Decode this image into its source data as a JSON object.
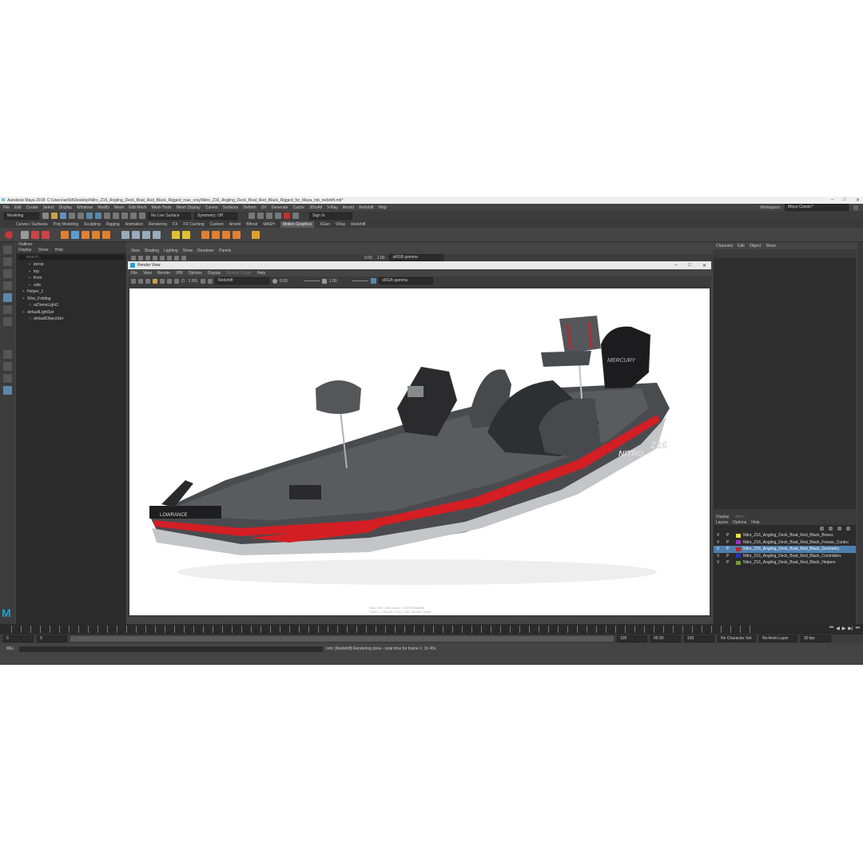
{
  "window": {
    "title": "Autodesk Maya 2018: C:\\Users\\art3d\\Desktop\\Nitro_Z16_Angling_Deck_Boat_Red_Black_Rigged_max_vray\\Nitro_Z16_Angling_Deck_Boat_Red_Black_Rigged_for_Maya_mb_redshift.mb*"
  },
  "menu": [
    "File",
    "Edit",
    "Create",
    "Select",
    "Display",
    "Windows",
    "Modify",
    "Mesh",
    "Edit Mesh",
    "Mesh Tools",
    "Mesh Display",
    "Curves",
    "Surfaces",
    "Deform",
    "UV",
    "Generate",
    "Cache",
    "3DtoAll",
    "V-Ray",
    "Arnold",
    "Redshift",
    "Help"
  ],
  "workspace": {
    "label": "Workspace :",
    "value": "Maya Classic*"
  },
  "status": {
    "mode": "Modeling",
    "live_surface": "No Live Surface",
    "symmetry": "Symmetry: Off",
    "sign_in": "Sign In"
  },
  "shelf_tabs": [
    "Curves / Surfaces",
    "Poly Modeling",
    "Sculpting",
    "Rigging",
    "Animation",
    "Rendering",
    "FX",
    "FX Caching",
    "Custom",
    "Arnold",
    "Bifrost",
    "MASH",
    "Motion Graphics",
    "XGen",
    "VRay",
    "Redshift"
  ],
  "shelf_active": "Motion Graphics",
  "outliner": {
    "title": "Outliner",
    "menu": [
      "Display",
      "Show",
      "Help"
    ],
    "search_placeholder": "search...",
    "items": [
      {
        "label": "persp",
        "glyph": "▪"
      },
      {
        "label": "top",
        "glyph": "▪"
      },
      {
        "label": "front",
        "glyph": "▪"
      },
      {
        "label": "side",
        "glyph": "▪"
      },
      {
        "label": "Helper_1",
        "glyph": "+"
      },
      {
        "label": "Wire_Folding",
        "glyph": "+"
      },
      {
        "label": "rsDomeLight1",
        "glyph": "○"
      },
      {
        "label": "defaultLightSet",
        "glyph": "+"
      },
      {
        "label": "defaultObjectSet",
        "glyph": "○"
      }
    ]
  },
  "viewport_menu": [
    "View",
    "Shading",
    "Lighting",
    "Show",
    "Renderer",
    "Panels"
  ],
  "viewport_tools": {
    "val1": "0.00",
    "val2": "1.00",
    "colorspace": "sRGB gamma"
  },
  "render_view": {
    "title": "Render View",
    "menu": [
      "File",
      "View",
      "Render",
      "IPR",
      "Options",
      "Display",
      "Render Single",
      "Help"
    ],
    "renderer": "Redshift",
    "exposure": "0.00",
    "gamma": "1.00",
    "colorspace": "sRGB gamma",
    "zoom": "(1 : 1.00)",
    "info_line1": "Size: 960 x 960  zoom: 1.000     (Redshift)",
    "info_line2": "Frame: 1     Render Time: 0:56     Camera: persp"
  },
  "boat_text": {
    "brand": "NITRO",
    "model": "Z16",
    "motor": "MERCURY",
    "sonar": "LOWRANCE"
  },
  "channel_box": {
    "menu": [
      "Channels",
      "Edit",
      "Object",
      "Show"
    ]
  },
  "layers": {
    "tabs": [
      "Display",
      "Anim"
    ],
    "menu": [
      "Layers",
      "Options",
      "Help"
    ],
    "items": [
      {
        "vis": "V",
        "pick": "P",
        "name": "Nitro_Z16_Angling_Deck_Boat_Red_Black_Bones",
        "color": "#e6e63a",
        "selected": false
      },
      {
        "vis": "V",
        "pick": "P",
        "name": "Nitro_Z16_Angling_Deck_Boat_Red_Black_Freeze_Contro",
        "color": "#a030c8",
        "selected": false
      },
      {
        "vis": "V",
        "pick": "P",
        "name": "Nitro_Z16_Angling_Deck_Boat_Red_Black_Geometry",
        "color": "#c82020",
        "selected": true
      },
      {
        "vis": "V",
        "pick": "P",
        "name": "Nitro_Z16_Angling_Deck_Boat_Red_Black_Controllers",
        "color": "#2030c8",
        "selected": false
      },
      {
        "vis": "V",
        "pick": "P",
        "name": "Nitro_Z16_Angling_Deck_Boat_Red_Black_Helpers",
        "color": "#70a030",
        "selected": false
      }
    ]
  },
  "range": {
    "start": "0",
    "start2": "0",
    "end": "100",
    "end2": "100",
    "current": "99.90",
    "fps": "30 fps",
    "char_set": "No Character Set",
    "anim_layer": "No Anim Layer"
  },
  "cmdline": {
    "lang": "MEL"
  },
  "help": {
    "text": "Info:  [Redshift] Rendering done - total time for frame 1: 1h 43s"
  }
}
